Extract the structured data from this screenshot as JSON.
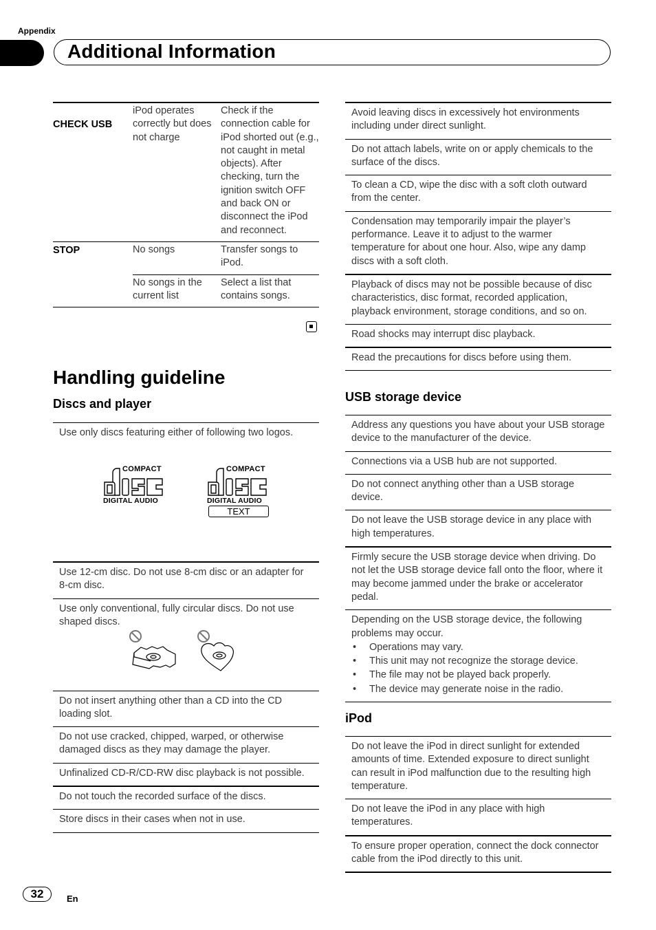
{
  "header": {
    "section_label": "Appendix",
    "title": "Additional Information"
  },
  "error_table": {
    "rows": [
      {
        "code": "CHECK USB",
        "entries": [
          {
            "cause": "iPod operates correctly but does not charge",
            "action": "Check if the connection cable for iPod shorted out (e.g., not caught in metal objects). After checking, turn the ignition switch OFF and back ON or disconnect the iPod and reconnect."
          }
        ]
      },
      {
        "code": "STOP",
        "entries": [
          {
            "cause": "No songs",
            "action": "Transfer songs to iPod."
          },
          {
            "cause": "No songs in the current list",
            "action": "Select a list that contains songs."
          }
        ]
      }
    ],
    "end_mark_icon": "end-of-section-icon"
  },
  "handling": {
    "title": "Handling guideline",
    "discs": {
      "title": "Discs and player",
      "logo_intro": "Use only discs featuring either of following two logos.",
      "logos": [
        {
          "top": "COMPACT",
          "main": "disc",
          "bottom": "DIGITAL AUDIO"
        },
        {
          "top": "COMPACT",
          "main": "disc",
          "bottom": "DIGITAL AUDIO",
          "badge": "TEXT"
        }
      ],
      "items_left": [
        "Use 12-cm disc. Do not use 8-cm disc or an adapter for 8-cm disc.",
        "Use only conventional, fully circular discs. Do not use shaped discs.",
        "Do not insert anything other than a CD into the CD loading slot.",
        "Do not use cracked, chipped, warped, or otherwise damaged discs as they may damage the player.",
        "Unfinalized CD-R/CD-RW disc playback is not possible.",
        "Do not touch the recorded surface of the discs.",
        "Store discs in their cases when not in use."
      ],
      "shaped_disc_icons": [
        "prohibited-icon",
        "octagon-shaped-disc-icon",
        "prohibited-icon",
        "heart-shaped-disc-icon"
      ],
      "items_right": [
        "Avoid leaving discs in excessively hot environments including under direct sunlight.",
        "Do not attach labels, write on or apply chemicals to the surface of the discs.",
        "To clean a CD, wipe the disc with a soft cloth outward from the center.",
        "Condensation may temporarily impair the player’s performance. Leave it to adjust to the warmer temperature for about one hour. Also, wipe any damp discs with a soft cloth.",
        "Playback of discs may not be possible because of disc characteristics, disc format, recorded application, playback environment, storage conditions, and so on.",
        "Road shocks may interrupt disc playback.",
        "Read the precautions for discs before using them."
      ]
    },
    "usb": {
      "title": "USB storage device",
      "items": [
        "Address any questions you have about your USB storage device to the manufacturer of the device.",
        "Connections via a USB hub are not supported.",
        "Do not connect anything other than a USB storage device.",
        "Do not leave the USB storage device in any place with high temperatures.",
        "Firmly secure the USB storage device when driving. Do not let the USB storage device fall onto the floor, where it may become jammed under the brake or accelerator pedal."
      ],
      "problems_intro": "Depending on the USB storage device, the following problems may occur.",
      "problems": [
        "Operations may vary.",
        "This unit may not recognize the storage device.",
        "The file may not be played back properly.",
        "The device may generate noise in the radio."
      ]
    },
    "ipod": {
      "title": "iPod",
      "items": [
        "Do not leave the iPod in direct sunlight for extended amounts of time. Extended exposure to direct sunlight can result in iPod malfunction due to the resulting high temperature.",
        "Do not leave the iPod in any place with high temperatures.",
        "To ensure proper operation, connect the dock connector cable from the iPod directly to this unit."
      ]
    }
  },
  "footer": {
    "page_number": "32",
    "language": "En"
  }
}
